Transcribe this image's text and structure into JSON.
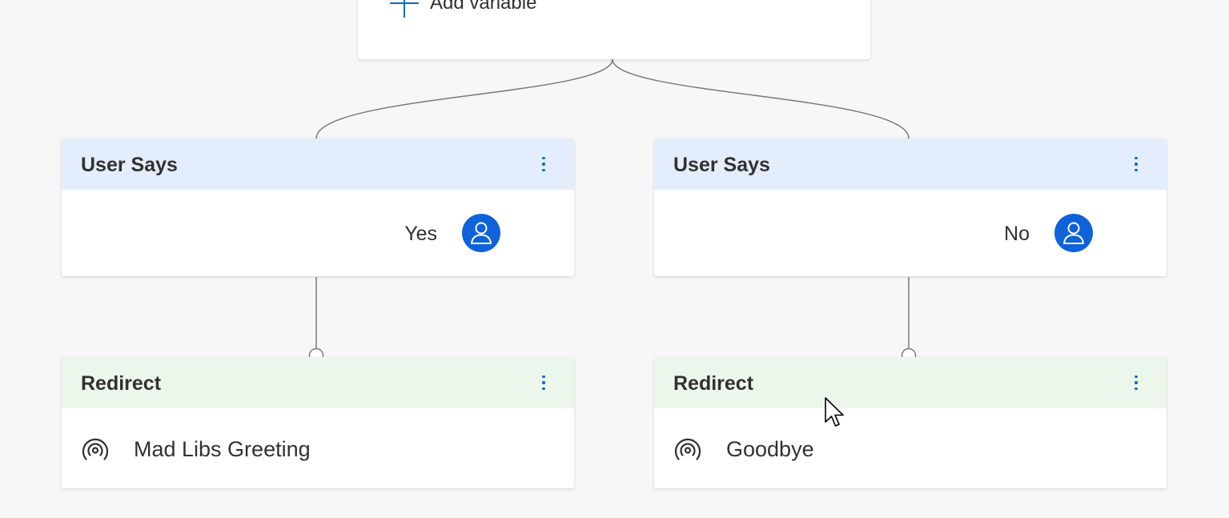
{
  "top_card": {
    "add_variable_label": "Add variable",
    "icon": "plus-icon"
  },
  "branches": [
    {
      "user_says": {
        "title": "User Says",
        "text": "Yes",
        "icon": "user-avatar-icon"
      },
      "redirect": {
        "title": "Redirect",
        "target": "Mad Libs Greeting",
        "icon": "broadcast-icon"
      }
    },
    {
      "user_says": {
        "title": "User Says",
        "text": "No",
        "icon": "user-avatar-icon"
      },
      "redirect": {
        "title": "Redirect",
        "target": "Goodbye",
        "icon": "broadcast-icon"
      }
    }
  ],
  "colors": {
    "canvas": "#f7f7f7",
    "user_header": "#e3edfb",
    "redirect_header": "#ecf7ec",
    "accent": "#0f6cbd",
    "avatar": "#0f62d9",
    "connector": "#7a7a7a"
  }
}
